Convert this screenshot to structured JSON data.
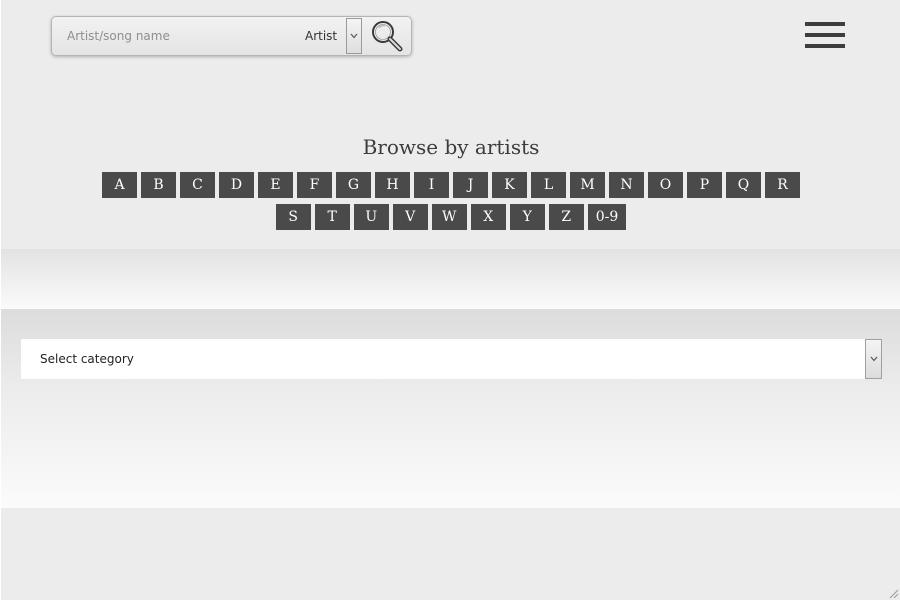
{
  "search": {
    "placeholder": "Artist/song name",
    "type_selected": "Artist"
  },
  "browse": {
    "title": "Browse by artists",
    "row1": [
      "A",
      "B",
      "C",
      "D",
      "E",
      "F",
      "G",
      "H",
      "I",
      "J",
      "K",
      "L",
      "M",
      "N",
      "O",
      "P",
      "Q",
      "R"
    ],
    "row2": [
      "S",
      "T",
      "U",
      "V",
      "W",
      "X",
      "Y",
      "Z",
      "0-9"
    ]
  },
  "category": {
    "selected": "Select category"
  },
  "icons": {
    "search": "magnifier-icon",
    "menu": "hamburger-menu-icon",
    "dropdown": "chevron-down-icon"
  },
  "colors": {
    "background": "#ececec",
    "letter_button": "#4a4a4a",
    "letter_text": "#ffffff"
  }
}
